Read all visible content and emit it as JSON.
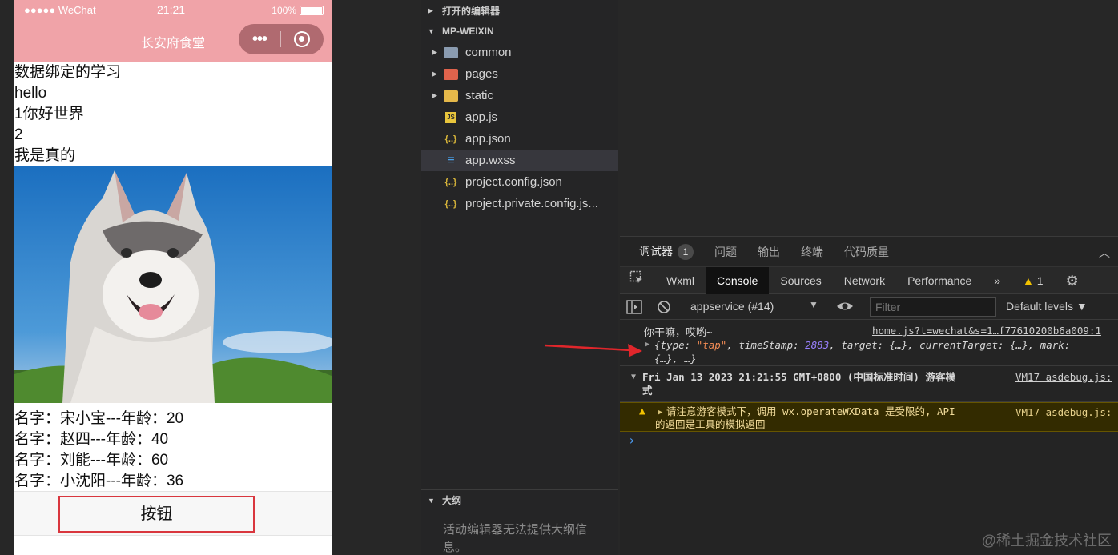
{
  "phone": {
    "status": {
      "carrier": "●●●●● WeChat",
      "time": "21:21",
      "battery": "100%"
    },
    "nav_title": "长安府食堂",
    "lines": [
      "数据绑定的学习",
      "hello",
      "1你好世界",
      "2",
      "我是真的"
    ],
    "people": [
      "名字：宋小宝---年龄：20",
      "名字：赵四---年龄：40",
      "名字：刘能---年龄：60",
      "名字：小沈阳---年龄：36"
    ],
    "button_label": "按钮"
  },
  "explorer": {
    "open_editors": "打开的编辑器",
    "project": "MP-WEIXIN",
    "items": [
      {
        "label": "common",
        "kind": "folder",
        "icon": "folder-icon"
      },
      {
        "label": "pages",
        "kind": "folder",
        "icon": "folder-pages-icon"
      },
      {
        "label": "static",
        "kind": "folder",
        "icon": "folder-static-icon"
      },
      {
        "label": "app.js",
        "kind": "file",
        "icon": "js-file-icon"
      },
      {
        "label": "app.json",
        "kind": "file",
        "icon": "json-file-icon"
      },
      {
        "label": "app.wxss",
        "kind": "file",
        "icon": "wxss-file-icon"
      },
      {
        "label": "project.config.json",
        "kind": "file",
        "icon": "json-file-icon"
      },
      {
        "label": "project.private.config.js...",
        "kind": "file",
        "icon": "json-file-icon"
      }
    ],
    "outline": "大纲",
    "outline_msg": "活动编辑器无法提供大纲信息。"
  },
  "devtools": {
    "top_tabs": [
      "调试器",
      "问题",
      "输出",
      "终端",
      "代码质量"
    ],
    "debugger_badge": "1",
    "panel_tabs": [
      "Wxml",
      "Console",
      "Sources",
      "Network",
      "Performance"
    ],
    "more": "»",
    "warn_count": "1",
    "context": "appservice (#14)",
    "filter_placeholder": "Filter",
    "levels": "Default levels ▼",
    "log1_text": "你干嘛，哎哟~",
    "log1_link": "home.js?t=wechat&s=1…f77610200b6a009:1",
    "log1_obj_a": "{type: ",
    "log1_obj_type": "\"tap\"",
    "log1_obj_b": ", timeStamp: ",
    "log1_obj_ts": "2883",
    "log1_obj_c": ", target: {…}, currentTarget: {…}, mark:",
    "log1_obj_d": "{…}, …}",
    "log2_line1": "Fri Jan 13 2023 21:21:55 GMT+0800 (中国标准时间) 游客模",
    "log2_line2": "式",
    "log2_link": "VM17 asdebug.js:",
    "warn_line1": "请注意游客模式下，调用 wx.operateWXData 是受限的, API",
    "warn_line2": "的返回是工具的模拟返回",
    "warn_link": "VM17 asdebug.js:",
    "prompt": "›"
  },
  "watermark": "@稀土掘金技术社区",
  "colors": {
    "nav_pink": "#f0a3a8",
    "button_border": "#d9363e",
    "arrow_red": "#e0262b"
  }
}
